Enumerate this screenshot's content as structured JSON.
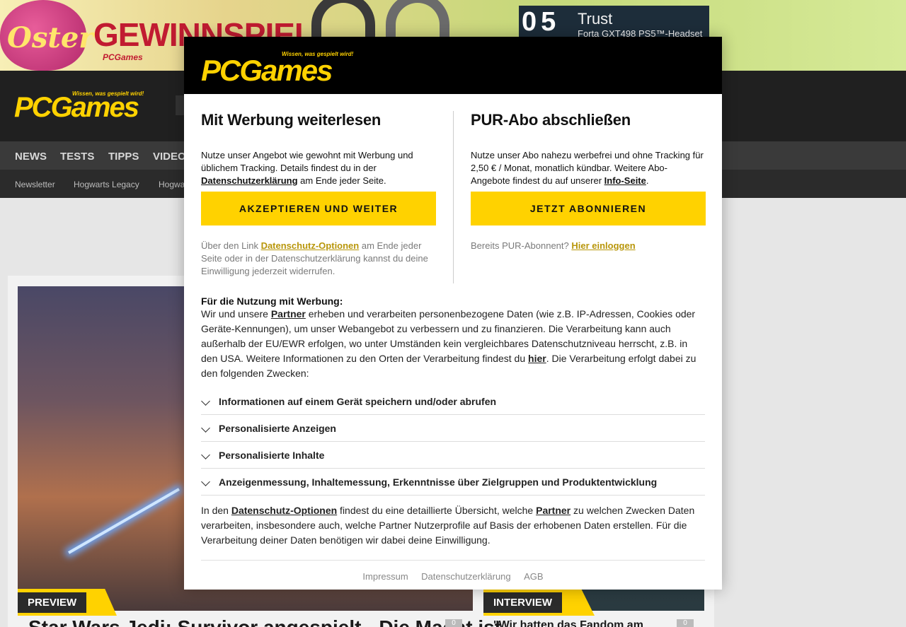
{
  "ad": {
    "egg_text": "Oster",
    "headline": "GEWINNSPIEL",
    "sub": "PCGames",
    "trust_num": "05",
    "trust_brand": "Trust",
    "trust_model": "Forta GXT498 PS5™-Headset"
  },
  "site": {
    "logo": "PCGames",
    "logo_tagline": "Wissen, was gespielt wird!",
    "nav": [
      "NEWS",
      "TESTS",
      "TIPPS",
      "VIDEO"
    ],
    "subnav": [
      "Newsletter",
      "Hogwarts Legacy",
      "Hogwa"
    ]
  },
  "content": {
    "hero_tag": "PREVIEW",
    "hero_title": "Star Wars Jedi: Survivor angespielt - Die Macht ist",
    "side_tag": "INTERVIEW",
    "side_title": "\"Wir hatten das Fandom am",
    "hero_count": "0",
    "side_count": "0"
  },
  "modal": {
    "logo": "PCGames",
    "logo_tagline": "Wissen, was gespielt wird!",
    "left": {
      "title": "Mit Werbung weiterlesen",
      "desc_1": "Nutze unser Angebot wie gewohnt mit Werbung und üblichem Tracking. Details findest du in der ",
      "desc_link": "Datenschutzerklärung",
      "desc_2": " am Ende jeder Seite.",
      "button": "AKZEPTIEREN UND WEITER",
      "note_1": "Über den Link ",
      "note_link": "Datenschutz-Optionen",
      "note_2": " am Ende jeder Seite oder in der Datenschutzerklärung kannst du deine Einwilligung jederzeit widerrufen."
    },
    "right": {
      "title": "PUR-Abo abschließen",
      "desc_1": "Nutze unser Abo nahezu werbefrei und ohne Tracking für 2,50 € / Monat, monatlich kündbar. Weitere Abo-Angebote findest du auf unserer ",
      "desc_link": "Info-Seite",
      "desc_2": ".",
      "button": "JETZT ABONNIEREN",
      "note_1": "Bereits PUR-Abonnent? ",
      "note_link": "Hier einloggen"
    },
    "consent": {
      "heading": "Für die Nutzung mit Werbung:",
      "text_1": "Wir und unsere ",
      "link_partner": "Partner",
      "text_2": " erheben und verarbeiten personenbezogene Daten (wie z.B. IP-Adressen, Cookies oder Geräte-Kennungen), um unser Webangebot zu verbessern und zu finanzieren. Die Verarbeitung kann auch außerhalb der EU/EWR erfolgen, wo unter Umständen kein vergleichbares Datenschutzniveau herrscht, z.B. in den USA. Weitere Informationen zu den Orten der Verarbeitung findest du ",
      "link_hier": "hier",
      "text_3": ". Die Verarbeitung erfolgt dabei zu den folgenden Zwecken:"
    },
    "purposes": [
      "Informationen auf einem Gerät speichern und/oder abrufen",
      "Personalisierte Anzeigen",
      "Personalisierte Inhalte",
      "Anzeigenmessung, Inhaltemessung, Erkenntnisse über Zielgruppen und Produktentwicklung"
    ],
    "more": {
      "text_1": "In den ",
      "link_options": "Datenschutz-Optionen",
      "text_2": " findest du eine detaillierte Übersicht, welche ",
      "link_partner": "Partner",
      "text_3": " zu welchen Zwecken Daten verarbeiten, insbesondere auch, welche Partner Nutzerprofile auf Basis der erhobenen Daten erstellen. Für die Verarbeitung deiner Daten benötigen wir dabei deine Einwilligung."
    },
    "footer": [
      "Impressum",
      "Datenschutzerklärung",
      "AGB"
    ]
  },
  "colors": {
    "accent": "#ffd200",
    "header_bg": "#000000",
    "nav_bg": "#3a3a3a"
  }
}
